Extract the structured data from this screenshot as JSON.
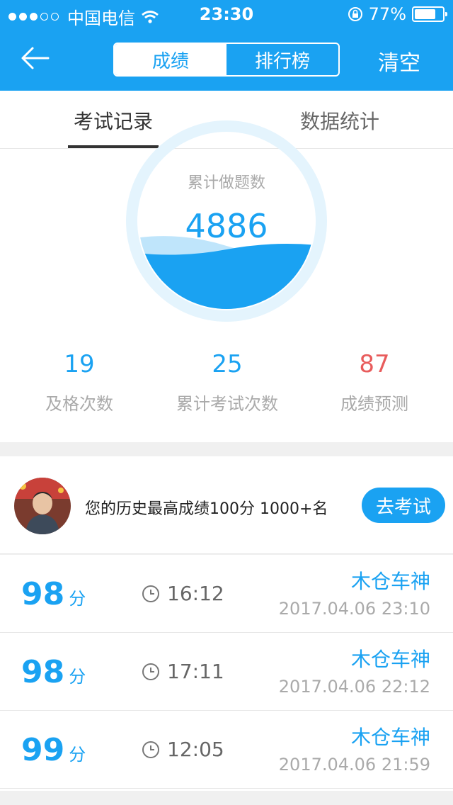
{
  "status_bar": {
    "carrier": "中国电信",
    "time": "23:30",
    "battery_pct": "77%",
    "battery_level": 0.77
  },
  "nav": {
    "segments": [
      "成绩",
      "排行榜"
    ],
    "active_segment": "成绩",
    "clear_label": "清空"
  },
  "tabs": [
    {
      "label": "考试记录",
      "active": true
    },
    {
      "label": "数据统计",
      "active": false
    }
  ],
  "summary": {
    "gauge_label": "累计做题数",
    "gauge_value": "4886",
    "stats": [
      {
        "value": "19",
        "label": "及格次数"
      },
      {
        "value": "25",
        "label": "累计考试次数"
      },
      {
        "value": "87",
        "label": "成绩预测"
      }
    ]
  },
  "best": {
    "text": "您的历史最高成绩100分  1000+名",
    "button": "去考试"
  },
  "records": [
    {
      "score": "98",
      "unit": "分",
      "duration": "16:12",
      "name": "木仓车神",
      "date": "2017.04.06 23:10"
    },
    {
      "score": "98",
      "unit": "分",
      "duration": "17:11",
      "name": "木仓车神",
      "date": "2017.04.06 22:12"
    },
    {
      "score": "99",
      "unit": "分",
      "duration": "12:05",
      "name": "木仓车神",
      "date": "2017.04.06 21:59"
    }
  ],
  "colors": {
    "accent": "#1aa2f2",
    "prediction": "#e85c5c",
    "muted_text": "#aaaaaa"
  }
}
